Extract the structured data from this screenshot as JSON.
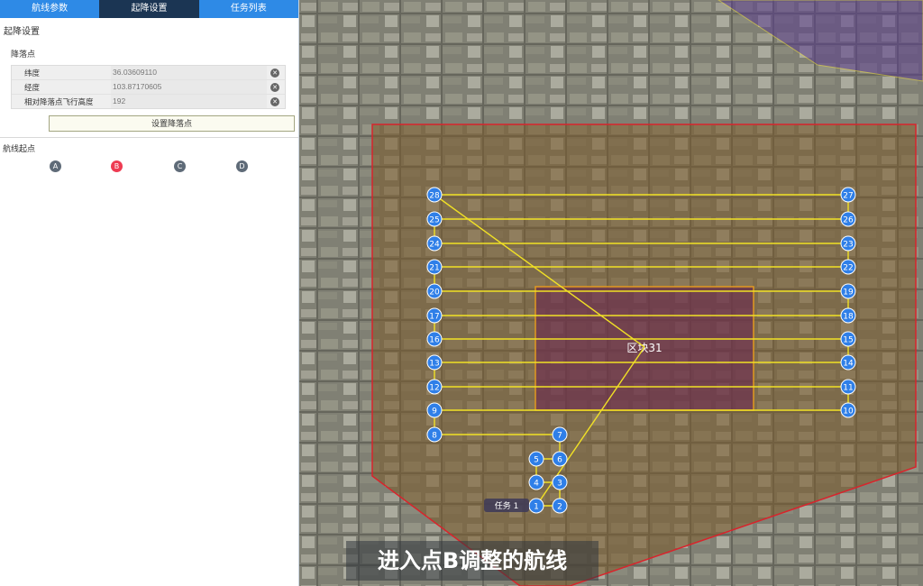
{
  "tabs": [
    {
      "label": "航线参数"
    },
    {
      "label": "起降设置"
    },
    {
      "label": "任务列表"
    }
  ],
  "panel": {
    "title": "起降设置",
    "landing_point_label": "降落点",
    "fields": [
      {
        "label": "纬度",
        "value": "36.03609110"
      },
      {
        "label": "经度",
        "value": "103.87170605"
      },
      {
        "label": "相对降落点飞行高度",
        "value": "192"
      }
    ],
    "set_button": "设置降落点",
    "route_start_label": "航线起点",
    "start_points": [
      {
        "label": "A",
        "selected": false
      },
      {
        "label": "B",
        "selected": true
      },
      {
        "label": "C",
        "selected": false
      },
      {
        "label": "D",
        "selected": false
      }
    ]
  },
  "map": {
    "block_label": "区块31",
    "task_label": "任务 1",
    "caption": "进入点B调整的航线",
    "waypoint_numbers": [
      "1",
      "2",
      "3",
      "4",
      "5",
      "6",
      "7",
      "8",
      "9",
      "10",
      "11",
      "12",
      "13",
      "14",
      "15",
      "16",
      "17",
      "18",
      "19",
      "20",
      "21",
      "22",
      "23",
      "24",
      "25",
      "26",
      "27",
      "28"
    ],
    "colors": {
      "accent_tab": "#2e8ae6",
      "active_tab": "#1b3553",
      "selected_start": "#ee3b52",
      "waypoint": "#2f7fe8",
      "route_line": "#f1e125",
      "boundary": "#d8242c",
      "inner_block": "#e29a1f"
    }
  }
}
